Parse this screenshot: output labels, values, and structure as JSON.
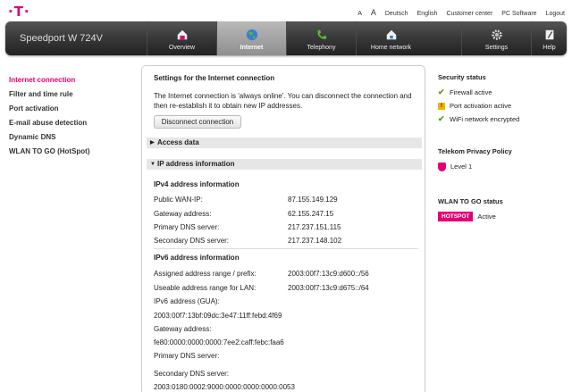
{
  "brand": {
    "logo_text": "·T·",
    "accent": "#e20074"
  },
  "toplinks": {
    "font_small": "A",
    "font_big": "A",
    "deutsch": "Deutsch",
    "english": "English",
    "customer_center": "Customer center",
    "pc_software": "PC Software",
    "logout": "Logout"
  },
  "nav": {
    "model": "Speedport W 724V",
    "overview": "Overview",
    "internet": "Internet",
    "telephony": "Telephony",
    "home_network": "Home network",
    "settings": "Settings",
    "help": "Help"
  },
  "sidebar": {
    "items": [
      {
        "label": "Internet connection"
      },
      {
        "label": "Filter and time rule"
      },
      {
        "label": "Port activation"
      },
      {
        "label": "E-mail abuse detection"
      },
      {
        "label": "Dynamic DNS"
      },
      {
        "label": "WLAN TO GO (HotSpot)"
      }
    ]
  },
  "main": {
    "title": "Settings for the Internet connection",
    "intro": "The Internet connection is 'always online'. You can disconnect the connection and then re-establish it to obtain new IP addresses.",
    "disconnect_button": "Disconnect connection",
    "access_data": "Access data",
    "ip_info": "IP address information",
    "ipv4": {
      "heading": "IPv4 address information",
      "public_wan_label": "Public WAN-IP:",
      "public_wan_value": "87.155.149.129",
      "gateway_label": "Gateway address:",
      "gateway_value": "62.155.247.15",
      "primary_dns_label": "Primary DNS server:",
      "primary_dns_value": "217.237.151.115",
      "secondary_dns_label": "Secondary DNS server:",
      "secondary_dns_value": "217.237.148.102"
    },
    "ipv6": {
      "heading": "IPv6 address information",
      "assigned_label": "Assigned address range / prefix:",
      "assigned_value": "2003:00f7:13c9:d600::/56",
      "usable_label": "Useable address range for LAN:",
      "usable_value": "2003:00f7:13c9:d675::/64",
      "gua_label": "IPv6 address (GUA):",
      "gua_value": "2003:00f7:13bf:09dc:3e47:11ff:febd:4f69",
      "gateway_label": "Gateway address:",
      "gateway_value": "fe80:0000:0000:0000:7ee2:caff:febc:faa6",
      "primary_dns_label": "Primary DNS server:",
      "secondary_dns_label": "Secondary DNS server:",
      "secondary_dns_value": "2003:0180:0002:9000:0000:0000:0000:0053"
    }
  },
  "right": {
    "security_title": "Security status",
    "firewall": "Firewall active",
    "port_activation": "Port activation active",
    "wifi": "WiFi network encrypted",
    "privacy_title": "Telekom Privacy Policy",
    "privacy_level": "Level 1",
    "wlan_title": "WLAN TO GO status",
    "hotspot_badge": "HOTSPOT",
    "hotspot_status": "Active"
  }
}
